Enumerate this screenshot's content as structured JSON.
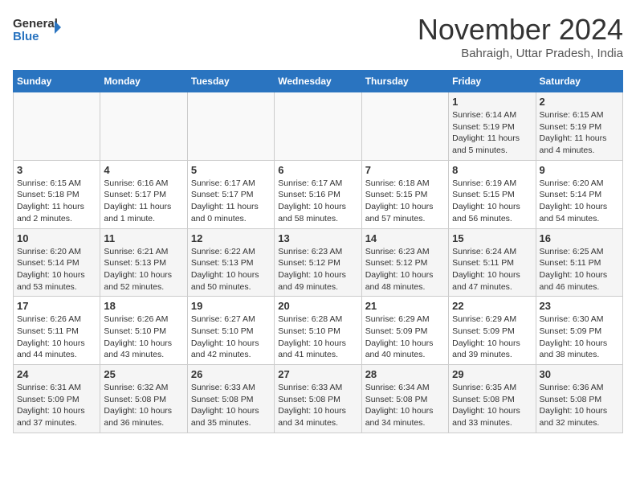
{
  "logo": {
    "line1": "General",
    "line2": "Blue"
  },
  "title": "November 2024",
  "subtitle": "Bahraigh, Uttar Pradesh, India",
  "days_of_week": [
    "Sunday",
    "Monday",
    "Tuesday",
    "Wednesday",
    "Thursday",
    "Friday",
    "Saturday"
  ],
  "weeks": [
    [
      {
        "day": "",
        "info": ""
      },
      {
        "day": "",
        "info": ""
      },
      {
        "day": "",
        "info": ""
      },
      {
        "day": "",
        "info": ""
      },
      {
        "day": "",
        "info": ""
      },
      {
        "day": "1",
        "info": "Sunrise: 6:14 AM\nSunset: 5:19 PM\nDaylight: 11 hours and 5 minutes."
      },
      {
        "day": "2",
        "info": "Sunrise: 6:15 AM\nSunset: 5:19 PM\nDaylight: 11 hours and 4 minutes."
      }
    ],
    [
      {
        "day": "3",
        "info": "Sunrise: 6:15 AM\nSunset: 5:18 PM\nDaylight: 11 hours and 2 minutes."
      },
      {
        "day": "4",
        "info": "Sunrise: 6:16 AM\nSunset: 5:17 PM\nDaylight: 11 hours and 1 minute."
      },
      {
        "day": "5",
        "info": "Sunrise: 6:17 AM\nSunset: 5:17 PM\nDaylight: 11 hours and 0 minutes."
      },
      {
        "day": "6",
        "info": "Sunrise: 6:17 AM\nSunset: 5:16 PM\nDaylight: 10 hours and 58 minutes."
      },
      {
        "day": "7",
        "info": "Sunrise: 6:18 AM\nSunset: 5:15 PM\nDaylight: 10 hours and 57 minutes."
      },
      {
        "day": "8",
        "info": "Sunrise: 6:19 AM\nSunset: 5:15 PM\nDaylight: 10 hours and 56 minutes."
      },
      {
        "day": "9",
        "info": "Sunrise: 6:20 AM\nSunset: 5:14 PM\nDaylight: 10 hours and 54 minutes."
      }
    ],
    [
      {
        "day": "10",
        "info": "Sunrise: 6:20 AM\nSunset: 5:14 PM\nDaylight: 10 hours and 53 minutes."
      },
      {
        "day": "11",
        "info": "Sunrise: 6:21 AM\nSunset: 5:13 PM\nDaylight: 10 hours and 52 minutes."
      },
      {
        "day": "12",
        "info": "Sunrise: 6:22 AM\nSunset: 5:13 PM\nDaylight: 10 hours and 50 minutes."
      },
      {
        "day": "13",
        "info": "Sunrise: 6:23 AM\nSunset: 5:12 PM\nDaylight: 10 hours and 49 minutes."
      },
      {
        "day": "14",
        "info": "Sunrise: 6:23 AM\nSunset: 5:12 PM\nDaylight: 10 hours and 48 minutes."
      },
      {
        "day": "15",
        "info": "Sunrise: 6:24 AM\nSunset: 5:11 PM\nDaylight: 10 hours and 47 minutes."
      },
      {
        "day": "16",
        "info": "Sunrise: 6:25 AM\nSunset: 5:11 PM\nDaylight: 10 hours and 46 minutes."
      }
    ],
    [
      {
        "day": "17",
        "info": "Sunrise: 6:26 AM\nSunset: 5:11 PM\nDaylight: 10 hours and 44 minutes."
      },
      {
        "day": "18",
        "info": "Sunrise: 6:26 AM\nSunset: 5:10 PM\nDaylight: 10 hours and 43 minutes."
      },
      {
        "day": "19",
        "info": "Sunrise: 6:27 AM\nSunset: 5:10 PM\nDaylight: 10 hours and 42 minutes."
      },
      {
        "day": "20",
        "info": "Sunrise: 6:28 AM\nSunset: 5:10 PM\nDaylight: 10 hours and 41 minutes."
      },
      {
        "day": "21",
        "info": "Sunrise: 6:29 AM\nSunset: 5:09 PM\nDaylight: 10 hours and 40 minutes."
      },
      {
        "day": "22",
        "info": "Sunrise: 6:29 AM\nSunset: 5:09 PM\nDaylight: 10 hours and 39 minutes."
      },
      {
        "day": "23",
        "info": "Sunrise: 6:30 AM\nSunset: 5:09 PM\nDaylight: 10 hours and 38 minutes."
      }
    ],
    [
      {
        "day": "24",
        "info": "Sunrise: 6:31 AM\nSunset: 5:09 PM\nDaylight: 10 hours and 37 minutes."
      },
      {
        "day": "25",
        "info": "Sunrise: 6:32 AM\nSunset: 5:08 PM\nDaylight: 10 hours and 36 minutes."
      },
      {
        "day": "26",
        "info": "Sunrise: 6:33 AM\nSunset: 5:08 PM\nDaylight: 10 hours and 35 minutes."
      },
      {
        "day": "27",
        "info": "Sunrise: 6:33 AM\nSunset: 5:08 PM\nDaylight: 10 hours and 34 minutes."
      },
      {
        "day": "28",
        "info": "Sunrise: 6:34 AM\nSunset: 5:08 PM\nDaylight: 10 hours and 34 minutes."
      },
      {
        "day": "29",
        "info": "Sunrise: 6:35 AM\nSunset: 5:08 PM\nDaylight: 10 hours and 33 minutes."
      },
      {
        "day": "30",
        "info": "Sunrise: 6:36 AM\nSunset: 5:08 PM\nDaylight: 10 hours and 32 minutes."
      }
    ]
  ]
}
